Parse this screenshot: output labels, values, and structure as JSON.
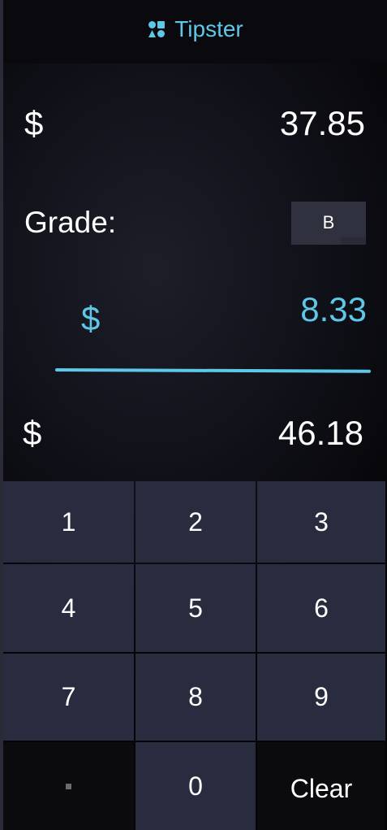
{
  "app": {
    "title": "Tipster",
    "title_icon": "shapes-icon",
    "accent_color": "#5ec8e8"
  },
  "bill": {
    "currency": "$",
    "amount": "37.85"
  },
  "grade": {
    "label": "Grade:",
    "selected": "B"
  },
  "tip": {
    "currency": "$",
    "amount": "8.33"
  },
  "total": {
    "currency": "$",
    "amount": "46.18"
  },
  "keypad": {
    "keys": [
      "1",
      "2",
      "3",
      "4",
      "5",
      "6",
      "7",
      "8",
      "9",
      ".",
      "0",
      "Clear"
    ]
  }
}
